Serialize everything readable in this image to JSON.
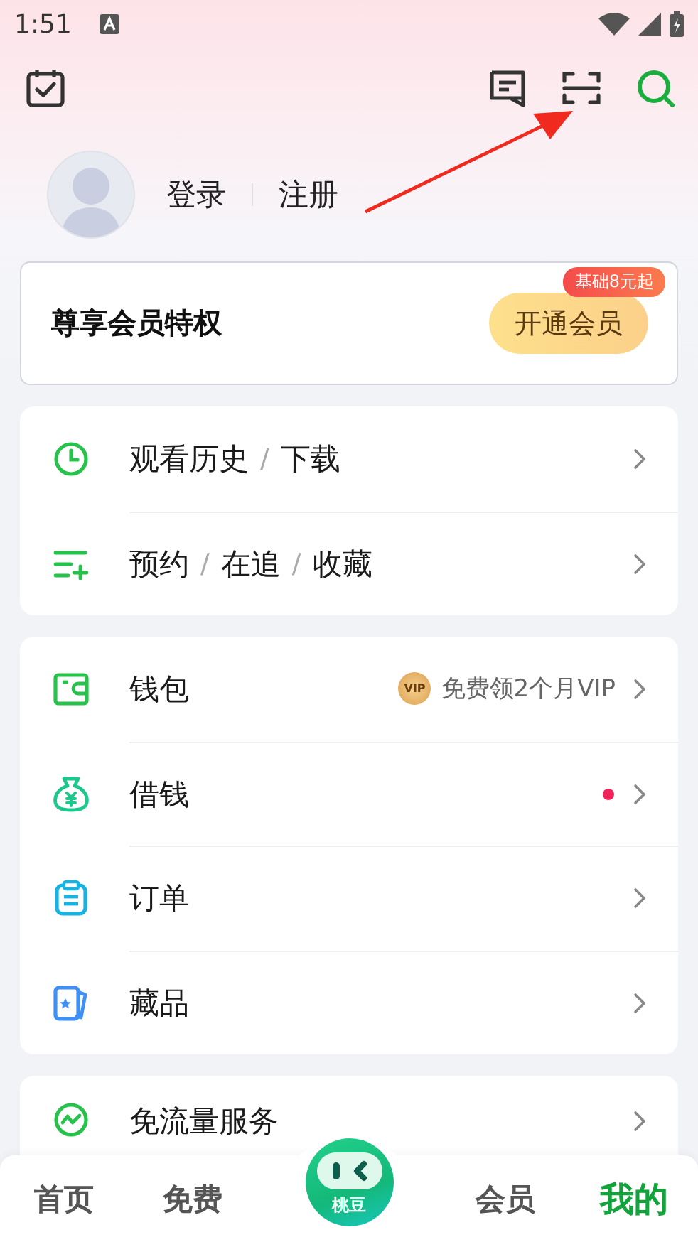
{
  "status_bar": {
    "time": "1:51"
  },
  "profile": {
    "login": "登录",
    "register": "注册"
  },
  "vip_card": {
    "title": "尊享会员特权",
    "button": "开通会员",
    "badge": "基础8元起"
  },
  "menu_groups": [
    {
      "items": [
        {
          "kind": "history",
          "parts": [
            "观看历史",
            "/",
            "下载"
          ]
        },
        {
          "kind": "list",
          "parts": [
            "预约",
            "/",
            "在追",
            "/",
            "收藏"
          ]
        }
      ]
    },
    {
      "items": [
        {
          "kind": "wallet",
          "parts": [
            "钱包"
          ],
          "promo": {
            "badge": "VIP",
            "text": "免费领2个月VIP"
          },
          "dot": false
        },
        {
          "kind": "loan",
          "parts": [
            "借钱"
          ],
          "dot": true
        },
        {
          "kind": "order",
          "parts": [
            "订单"
          ],
          "dot": false
        },
        {
          "kind": "collection",
          "parts": [
            "藏品"
          ],
          "dot": false
        }
      ]
    },
    {
      "items": [
        {
          "kind": "traffic",
          "parts": [
            "免流量服务"
          ]
        }
      ]
    }
  ],
  "tab_bar": {
    "tabs": [
      {
        "label": "首页",
        "selected": false
      },
      {
        "label": "免费",
        "selected": false
      },
      {
        "label": "桃豆",
        "kind": "center"
      },
      {
        "label": "会员",
        "selected": false
      },
      {
        "label": "我的",
        "selected": true
      }
    ]
  }
}
